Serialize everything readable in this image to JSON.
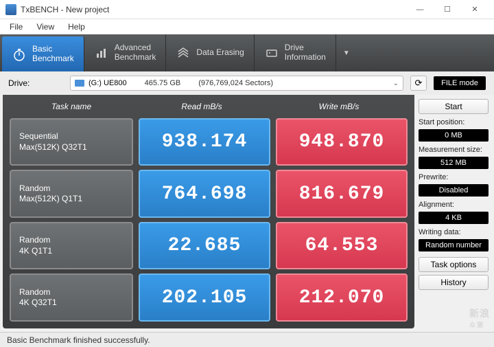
{
  "window": {
    "title": "TxBENCH - New project"
  },
  "menu": {
    "file": "File",
    "view": "View",
    "help": "Help"
  },
  "toolbar": {
    "basic": "Basic\nBenchmark",
    "advanced": "Advanced\nBenchmark",
    "erasing": "Data Erasing",
    "driveinfo": "Drive\nInformation"
  },
  "drive": {
    "label": "Drive:",
    "name": "(G:) UE800",
    "size": "465.75 GB",
    "sectors": "(976,769,024 Sectors)",
    "filemode": "FILE mode"
  },
  "headers": {
    "task": "Task name",
    "read": "Read mB/s",
    "write": "Write mB/s"
  },
  "rows": [
    {
      "t1": "Sequential",
      "t2": "Max(512K) Q32T1",
      "read": "938.174",
      "write": "948.870"
    },
    {
      "t1": "Random",
      "t2": "Max(512K) Q1T1",
      "read": "764.698",
      "write": "816.679"
    },
    {
      "t1": "Random",
      "t2": "4K Q1T1",
      "read": "22.685",
      "write": "64.553"
    },
    {
      "t1": "Random",
      "t2": "4K Q32T1",
      "read": "202.105",
      "write": "212.070"
    }
  ],
  "side": {
    "start": "Start",
    "startpos_l": "Start position:",
    "startpos_v": "0 MB",
    "meassize_l": "Measurement size:",
    "meassize_v": "512 MB",
    "prewrite_l": "Prewrite:",
    "prewrite_v": "Disabled",
    "align_l": "Alignment:",
    "align_v": "4 KB",
    "wdata_l": "Writing data:",
    "wdata_v": "Random number",
    "taskopt": "Task options",
    "history": "History"
  },
  "status": "Basic Benchmark finished successfully.",
  "watermark": {
    "l1": "新浪",
    "l2": "众测"
  }
}
